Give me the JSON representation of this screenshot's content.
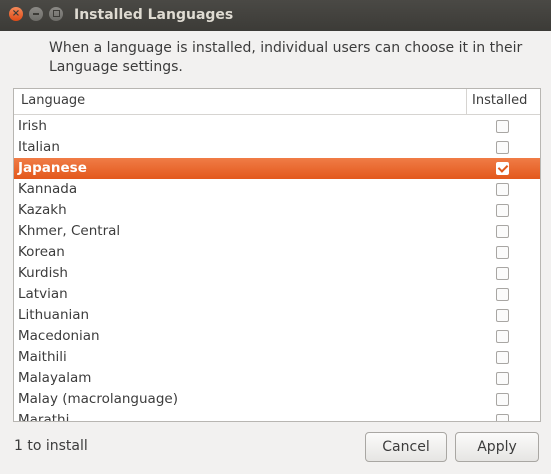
{
  "window": {
    "title": "Installed Languages"
  },
  "description": "When a language is installed, individual users can choose it in their Language settings.",
  "table": {
    "headers": {
      "language": "Language",
      "installed": "Installed"
    },
    "rows": [
      {
        "name": "Irish",
        "installed": false
      },
      {
        "name": "Italian",
        "installed": false
      },
      {
        "name": "Japanese",
        "installed": true
      },
      {
        "name": "Kannada",
        "installed": false
      },
      {
        "name": "Kazakh",
        "installed": false
      },
      {
        "name": "Khmer, Central",
        "installed": false
      },
      {
        "name": "Korean",
        "installed": false
      },
      {
        "name": "Kurdish",
        "installed": false
      },
      {
        "name": "Latvian",
        "installed": false
      },
      {
        "name": "Lithuanian",
        "installed": false
      },
      {
        "name": "Macedonian",
        "installed": false
      },
      {
        "name": "Maithili",
        "installed": false
      },
      {
        "name": "Malayalam",
        "installed": false
      },
      {
        "name": "Malay (macrolanguage)",
        "installed": false
      },
      {
        "name": "Marathi",
        "installed": false
      }
    ],
    "selected_row": "Japanese"
  },
  "footer": {
    "status": "1 to install",
    "cancel_label": "Cancel",
    "apply_label": "Apply"
  },
  "colors": {
    "accent": "#e95420",
    "titlebar": "#3c3b37"
  }
}
